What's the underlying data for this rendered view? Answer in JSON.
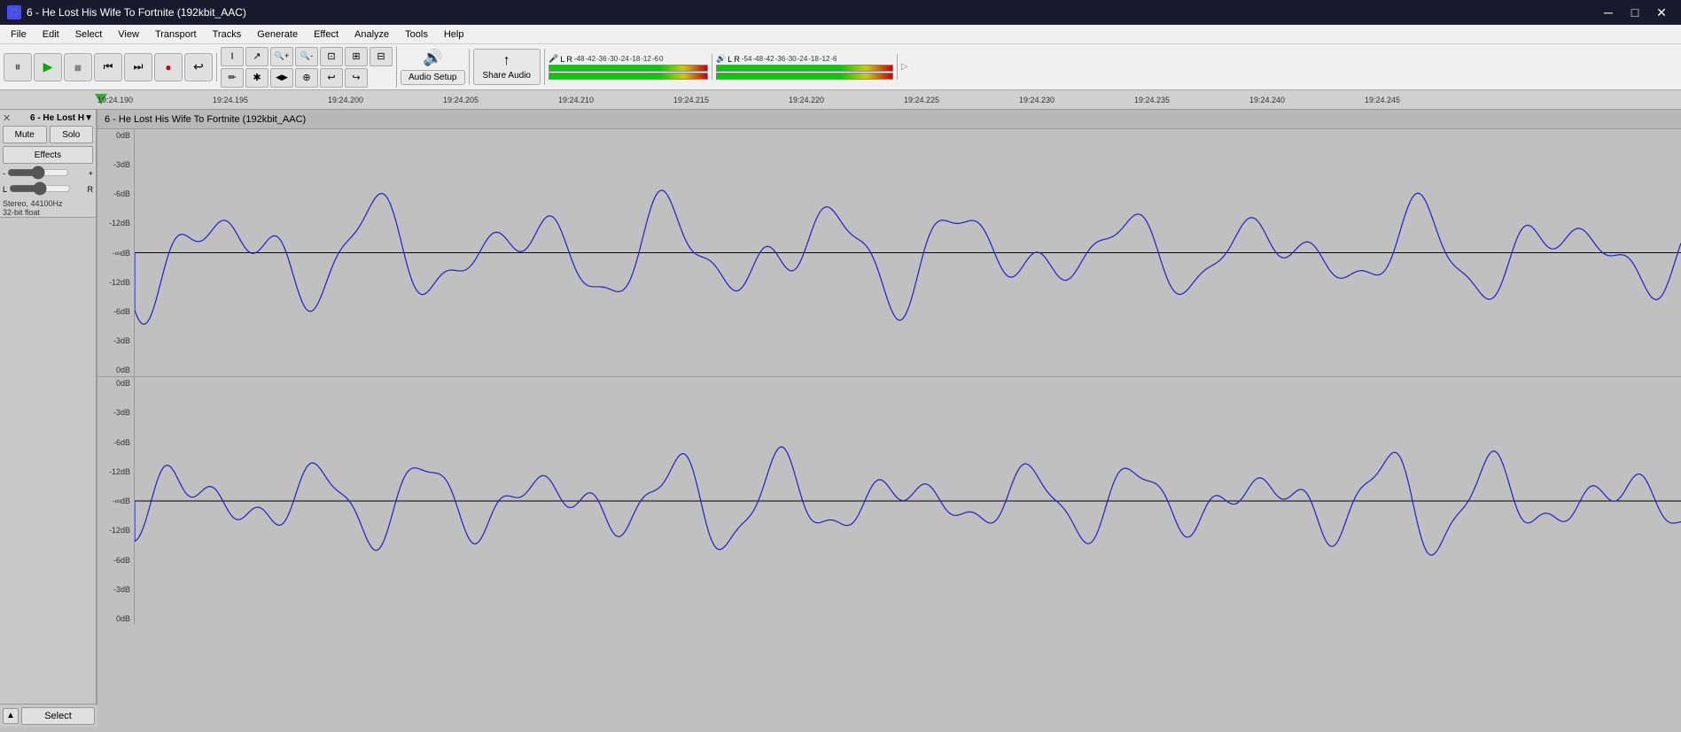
{
  "window": {
    "title": "6 - He Lost His Wife To Fortnite (192kbit_AAC)",
    "icon": "🎵"
  },
  "menu": {
    "items": [
      "File",
      "Edit",
      "Select",
      "View",
      "Transport",
      "Tracks",
      "Generate",
      "Effect",
      "Analyze",
      "Tools",
      "Help"
    ]
  },
  "toolbar": {
    "transport": {
      "pause_label": "⏸",
      "play_label": "▶",
      "stop_label": "■",
      "skip_start_label": "⏮",
      "skip_end_label": "⏭",
      "record_label": "●",
      "loop_label": "↩"
    },
    "tools": {
      "select_label": "I",
      "envelope_label": "↗",
      "zoom_in_label": "🔍+",
      "zoom_out_label": "🔍-",
      "fit_label": "⊡",
      "zoom_sel_label": "⊠",
      "zoom_toggle_label": "⊟",
      "draw_label": "✏",
      "multi_label": "✱",
      "time_shift_label": "◀▶",
      "multi2_label": "⊕",
      "undo_label": "↩",
      "redo_label": "↪"
    },
    "audio_setup": {
      "icon": "🔊",
      "label": "Audio Setup"
    },
    "share_audio": {
      "icon": "↑",
      "label": "Share Audio"
    },
    "mic_meter": {
      "label": "L R",
      "levels": [
        -48,
        -42,
        -36,
        -30,
        -24,
        -18,
        -12,
        -6,
        0
      ]
    },
    "out_meter": {
      "label": "L R",
      "levels": [
        -54,
        -48,
        -42,
        -36,
        -30,
        -24,
        -18,
        -12,
        -6
      ]
    }
  },
  "ruler": {
    "timestamps": [
      "19:24.190",
      "19:24.195",
      "19:24.200",
      "19:24.205",
      "19:24.210",
      "19:24.215",
      "19:24.220",
      "19:24.225",
      "19:24.230",
      "19:24.235",
      "19:24.240",
      "19:24.245",
      "19:24.2"
    ]
  },
  "track": {
    "name": "6 - He Lost H▼",
    "full_name": "6 - He Lost His Wife To Fortnite (192kbit_AAC)",
    "mute_label": "Mute",
    "solo_label": "Solo",
    "effects_label": "Effects",
    "gain_min": "-",
    "gain_max": "+",
    "pan_left": "L",
    "pan_right": "R",
    "info": "Stereo, 44100Hz\n32-bit float",
    "db_labels_top": [
      "0dB",
      "-3dB",
      "-6dB",
      "-12dB",
      "-∞dB",
      "-12dB",
      "-6dB",
      "-3dB",
      "0dB"
    ],
    "db_labels_bottom": [
      "0dB",
      "-3dB",
      "-6dB",
      "-12dB",
      "-∞dB",
      "-12dB",
      "-6dB",
      "-3dB",
      "0dB"
    ]
  },
  "bottom_bar": {
    "collapse_icon": "▲",
    "select_label": "Select"
  }
}
